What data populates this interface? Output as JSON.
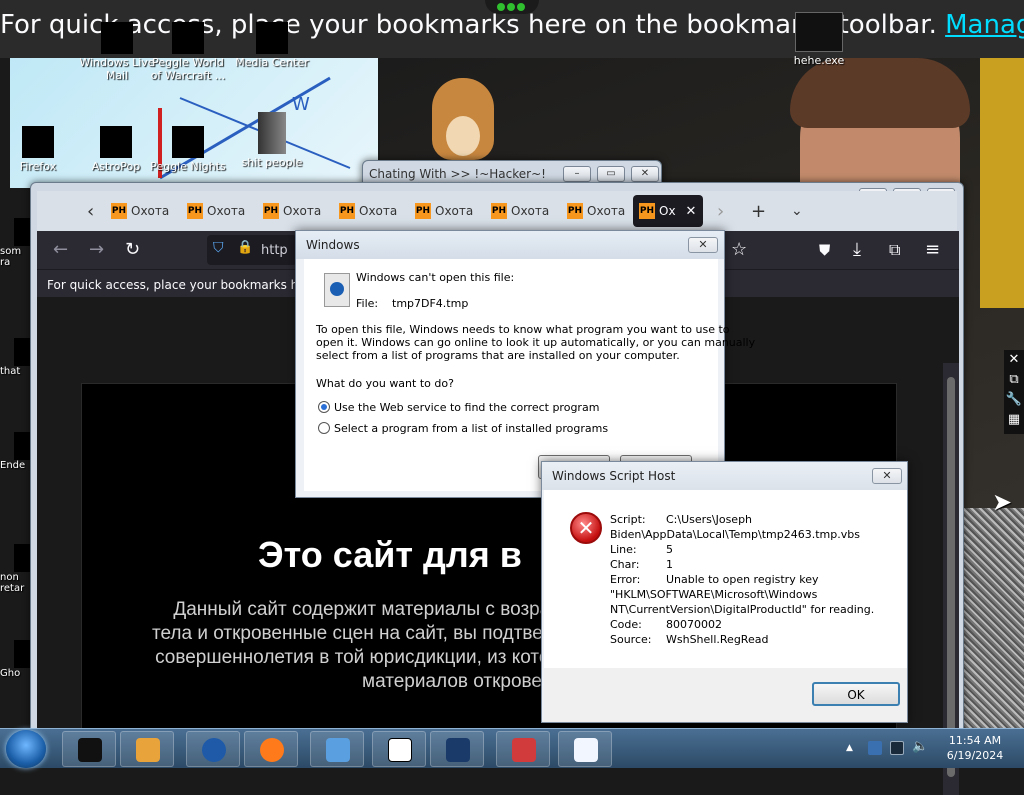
{
  "top_hint": {
    "text": "For quick access, place your bookmarks here on the bookmarks toolbar.",
    "link": "Manage bookmarks…"
  },
  "desktop_icons": [
    {
      "label": "Windows Live Mail"
    },
    {
      "label": "Peggle World of Warcraft ..."
    },
    {
      "label": "Media Center"
    },
    {
      "label": "hehe.exe"
    },
    {
      "label": "Firefox"
    },
    {
      "label": "AstroPop"
    },
    {
      "label": "Peggle Nights"
    },
    {
      "label": "shit people"
    }
  ],
  "side_icons": [
    {
      "label": "som ra"
    },
    {
      "label": "that"
    },
    {
      "label": "Ende"
    },
    {
      "label": "non retar"
    },
    {
      "label": "Gho"
    }
  ],
  "chat_window": {
    "title": "Chating With >> !~Hacker~!"
  },
  "firefox": {
    "tabs": [
      {
        "label": "Охота"
      },
      {
        "label": "Охота"
      },
      {
        "label": "Охота"
      },
      {
        "label": "Охота"
      },
      {
        "label": "Охота"
      },
      {
        "label": "Охота"
      },
      {
        "label": "Охота"
      },
      {
        "label": "Ох"
      }
    ],
    "tab_favicon": "PH",
    "url_text": "http",
    "bookmarks_hint": "For quick access, place your bookmarks here or",
    "page_title": "Это сайт для в",
    "page_text": "Данный сайт содержит материалы с возрас обнаженные части тела и откровенные сцен на сайт, вы подтверждаете, что вам испол совершеннолетия в той юрисдикции, из кото согласие на просмотр материалов открове"
  },
  "open_with_dialog": {
    "title": "Windows",
    "heading": "Windows can't open this file:",
    "file_label": "File:",
    "file_name": "tmp7DF4.tmp",
    "explanation_1": "To open this file, Windows needs to know what program you want to use to",
    "explanation_2": "open it. Windows can go online to look it up automatically, or you can manually",
    "explanation_3": "select from a list of programs that are installed on your computer.",
    "question": "What do you want to do?",
    "option_web": "Use the Web service to find the correct program",
    "option_list": "Select a program from a list of installed programs",
    "selected": "web"
  },
  "wsh_dialog": {
    "title": "Windows Script Host",
    "rows": [
      {
        "key": "Script:",
        "value": "C:\\Users\\Joseph"
      },
      {
        "key": "",
        "value": "Biden\\AppData\\Local\\Temp\\tmp2463.tmp.vbs"
      },
      {
        "key": "Line:",
        "value": "5"
      },
      {
        "key": "Char:",
        "value": "1"
      },
      {
        "key": "Error:",
        "value": "Unable to open registry key"
      },
      {
        "key": "",
        "value": "\"HKLM\\SOFTWARE\\Microsoft\\Windows"
      },
      {
        "key": "",
        "value": "NT\\CurrentVersion\\DigitalProductId\" for reading."
      },
      {
        "key": "Code:",
        "value": "80070002"
      },
      {
        "key": "Source:",
        "value": "WshShell.RegRead"
      }
    ],
    "ok_label": "OK"
  },
  "taskbar": {
    "time": "11:54 AM",
    "date": "6/19/2024",
    "items": [
      {
        "icon": "black-box-icon",
        "color": "#111111"
      },
      {
        "icon": "media-player-icon",
        "color": "#e8a33a"
      },
      {
        "icon": "globe-icon",
        "color": "#1e5aa8"
      },
      {
        "icon": "firefox-icon",
        "color": "#ff7a1a"
      },
      {
        "icon": "people-icon",
        "color": "#5aa0e0"
      },
      {
        "icon": "7zip-icon",
        "color": "#ffffff"
      },
      {
        "icon": "tablet-icon",
        "color": "#1a3a6a"
      },
      {
        "icon": "blocks-icon",
        "color": "#d23b3b"
      },
      {
        "icon": "document-icon",
        "color": "#f2f6ff"
      }
    ]
  }
}
